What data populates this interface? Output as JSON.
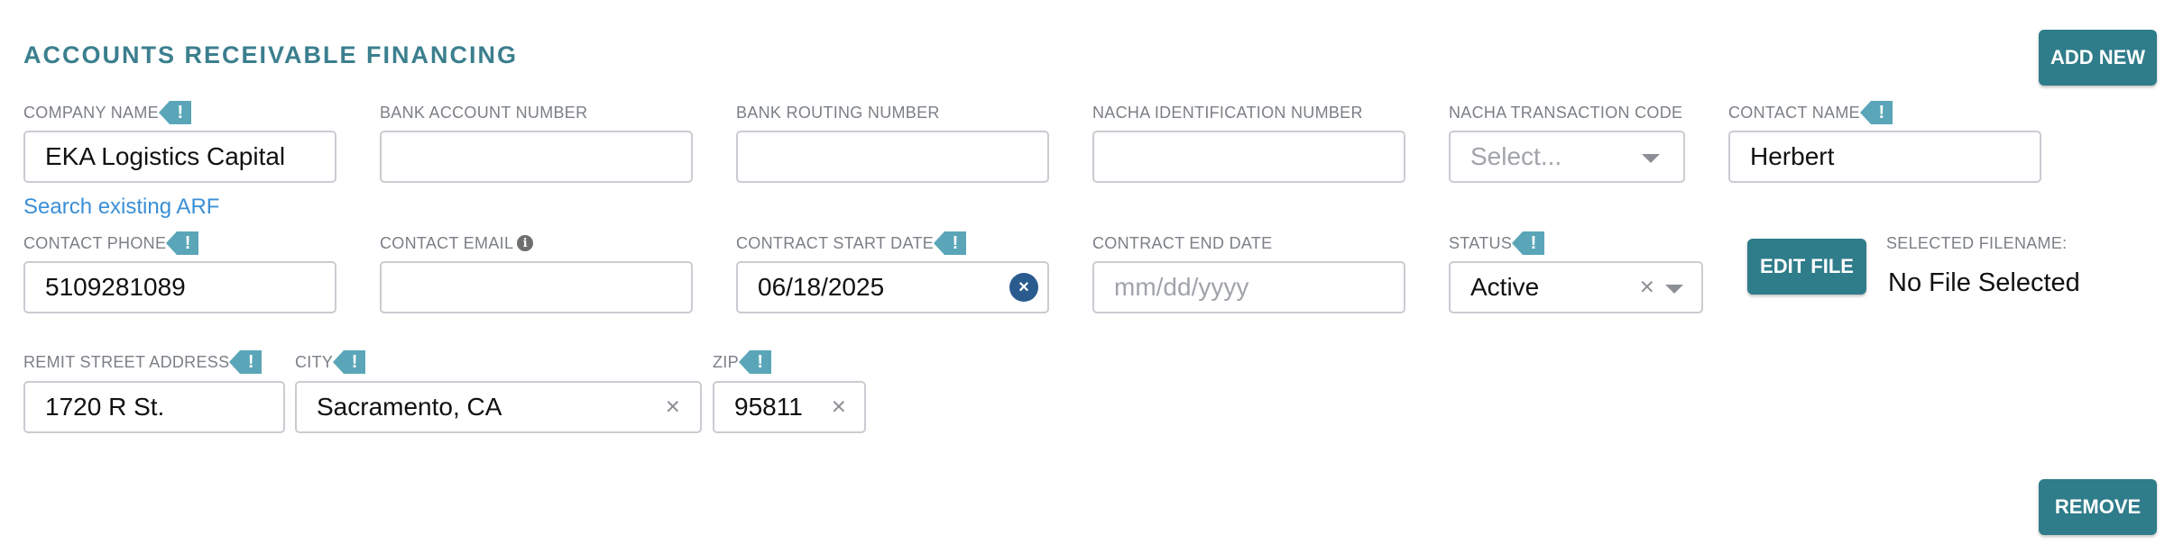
{
  "section_title": "ACCOUNTS RECEIVABLE FINANCING",
  "add_new_label": "ADD NEW",
  "remove_label": "REMOVE",
  "search_link": "Search existing ARF",
  "required_marker": "!",
  "info_marker": "i",
  "clear_marker": "×",
  "fields": {
    "company_name": {
      "label": "COMPANY NAME",
      "value": "EKA Logistics Capital"
    },
    "bank_account": {
      "label": "BANK ACCOUNT NUMBER",
      "value": ""
    },
    "bank_routing": {
      "label": "BANK ROUTING NUMBER",
      "value": ""
    },
    "nacha_id": {
      "label": "NACHA IDENTIFICATION NUMBER",
      "value": ""
    },
    "nacha_code": {
      "label": "NACHA TRANSACTION CODE",
      "placeholder": "Select..."
    },
    "contact_name": {
      "label": "CONTACT NAME",
      "value": "Herbert"
    },
    "contact_phone": {
      "label": "CONTACT PHONE",
      "value": "5109281089"
    },
    "contact_email": {
      "label": "CONTACT EMAIL",
      "value": ""
    },
    "start_date": {
      "label": "CONTRACT START DATE",
      "value": "06/18/2025"
    },
    "end_date": {
      "label": "CONTRACT END DATE",
      "placeholder": "mm/dd/yyyy"
    },
    "status": {
      "label": "STATUS",
      "value": "Active"
    },
    "remit_street": {
      "label": "REMIT STREET ADDRESS",
      "value": "1720 R St."
    },
    "city": {
      "label": "CITY",
      "value": "Sacramento, CA"
    },
    "zip": {
      "label": "ZIP",
      "value": "95811"
    }
  },
  "file": {
    "edit_label": "EDIT FILE",
    "selected_label": "SELECTED FILENAME:",
    "selected_value": "No File Selected"
  },
  "colors": {
    "accent": "#2f7c8a",
    "title": "#3b7f8e",
    "required_tag": "#5aa6b8",
    "link": "#3a8fd6",
    "clear_button": "#2a5b8f"
  }
}
